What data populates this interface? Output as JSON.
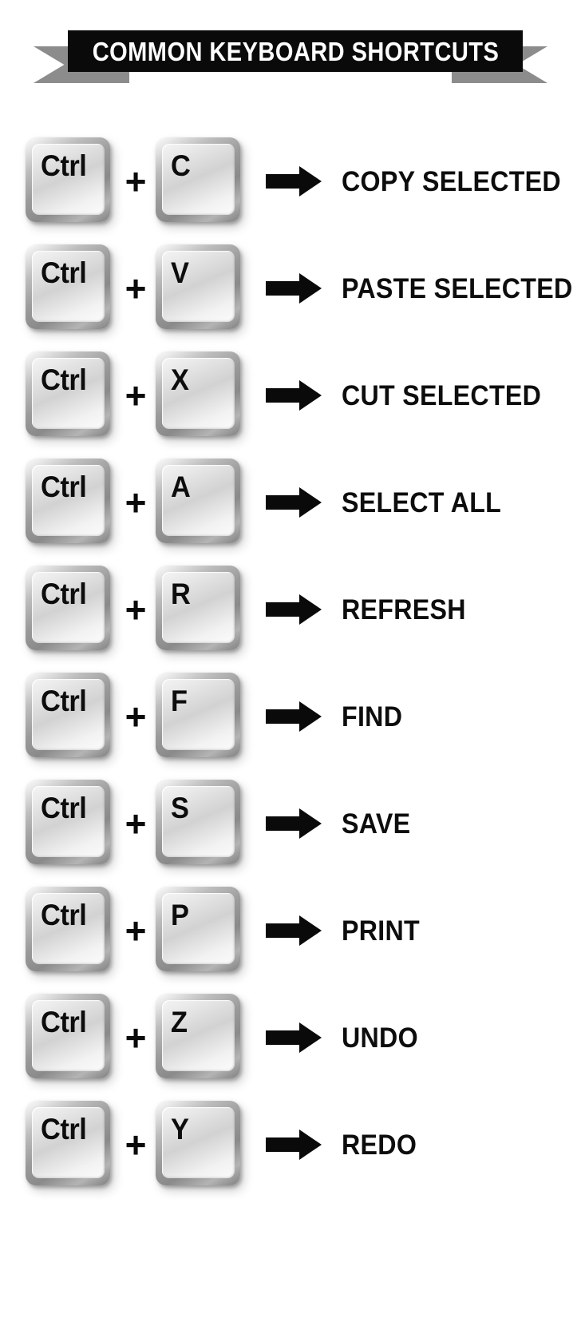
{
  "banner": {
    "title": "COMMON KEYBOARD SHORTCUTS",
    "plate_color": "#0a0a0a",
    "ribbon_color": "#8c8c8c",
    "title_color": "#ffffff"
  },
  "separator": {
    "plus": "+",
    "arrow_icon": "arrow-right-icon"
  },
  "shortcuts": [
    {
      "modifier": "Ctrl",
      "key": "C",
      "action": "COPY SELECTED"
    },
    {
      "modifier": "Ctrl",
      "key": "V",
      "action": "PASTE SELECTED"
    },
    {
      "modifier": "Ctrl",
      "key": "X",
      "action": "CUT SELECTED"
    },
    {
      "modifier": "Ctrl",
      "key": "A",
      "action": "SELECT ALL"
    },
    {
      "modifier": "Ctrl",
      "key": "R",
      "action": "REFRESH"
    },
    {
      "modifier": "Ctrl",
      "key": "F",
      "action": "FIND"
    },
    {
      "modifier": "Ctrl",
      "key": "S",
      "action": "SAVE"
    },
    {
      "modifier": "Ctrl",
      "key": "P",
      "action": "PRINT"
    },
    {
      "modifier": "Ctrl",
      "key": "Z",
      "action": "UNDO"
    },
    {
      "modifier": "Ctrl",
      "key": "Y",
      "action": "REDO"
    }
  ]
}
